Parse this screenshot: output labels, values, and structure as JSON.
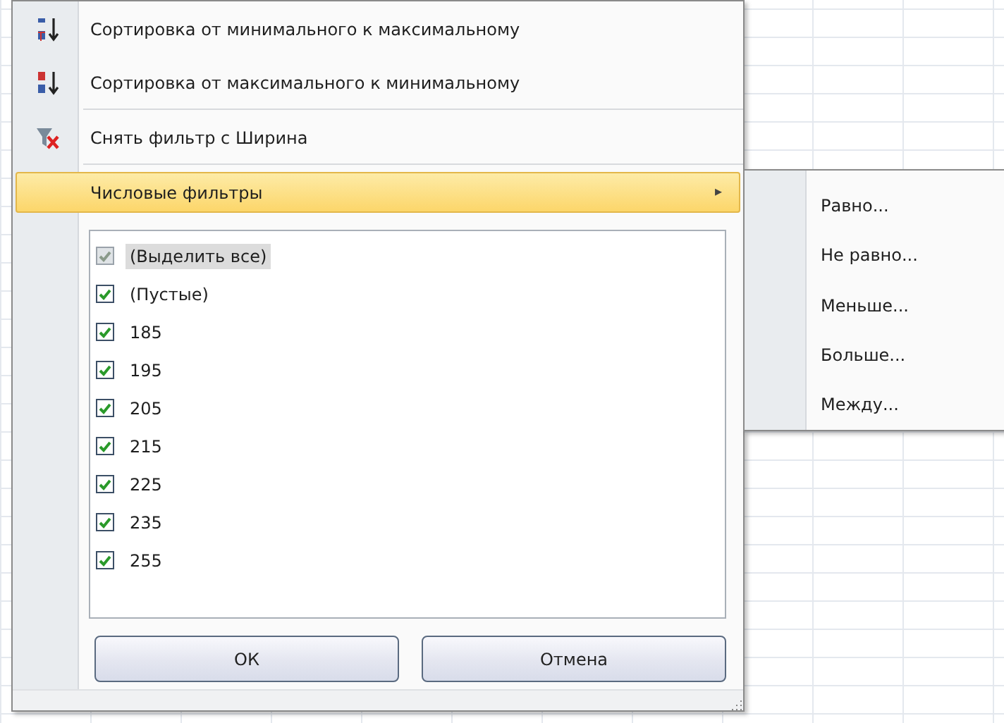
{
  "menu_items": [
    {
      "kind": "sort-asc",
      "label": "Сортировка от минимального к максимальному",
      "selected": false
    },
    {
      "kind": "sort-desc",
      "label": "Сортировка от максимального к минимальному",
      "selected": false
    },
    {
      "kind": "clear-filter",
      "label": "Снять фильтр с Ширина",
      "selected": false
    },
    {
      "kind": "submenu",
      "label": "Числовые фильтры",
      "arrow": "▸",
      "selected": true
    }
  ],
  "values": [
    {
      "label": "(Выделить все)",
      "checked": true,
      "selected": true
    },
    {
      "label": "(Пустые)",
      "checked": true,
      "selected": false
    },
    {
      "label": "185",
      "checked": true,
      "selected": false
    },
    {
      "label": "195",
      "checked": true,
      "selected": false
    },
    {
      "label": "205",
      "checked": true,
      "selected": false
    },
    {
      "label": "215",
      "checked": true,
      "selected": false
    },
    {
      "label": "225",
      "checked": true,
      "selected": false
    },
    {
      "label": "235",
      "checked": true,
      "selected": false
    },
    {
      "label": "255",
      "checked": true,
      "selected": false
    }
  ],
  "buttons": [
    "ОК",
    "Отмена"
  ],
  "submenu": [
    "Равно...",
    "Не равно...",
    "Меньше...",
    "Больше...",
    "Между..."
  ]
}
